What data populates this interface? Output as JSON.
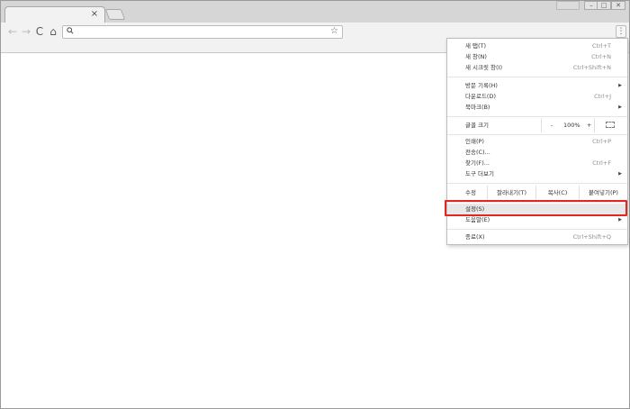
{
  "browser": {
    "tab_close": "×",
    "nav": {
      "back": "←",
      "forward": "→",
      "reload": "C",
      "home": "⌂"
    },
    "omnibox": {
      "value": ""
    },
    "menu_button": "⋮",
    "window_controls": {
      "minimize": "–",
      "maximize": "□",
      "close": "✕"
    }
  },
  "menu": {
    "group1": [
      {
        "label": "새 탭(T)",
        "shortcut": "Ctrl+T"
      },
      {
        "label": "새 창(N)",
        "shortcut": "Ctrl+N"
      },
      {
        "label": "새 시크릿 창(I)",
        "shortcut": "Ctrl+Shift+N"
      }
    ],
    "group2": [
      {
        "label": "방문 기록(H)",
        "shortcut": ""
      },
      {
        "label": "다운로드(D)",
        "shortcut": "Ctrl+J"
      },
      {
        "label": "북마크(B)",
        "shortcut": ""
      }
    ],
    "zoom": {
      "label": "글꼴 크기",
      "minus": "-",
      "value": "100%",
      "plus": "+"
    },
    "group3": [
      {
        "label": "인쇄(P)",
        "shortcut": "Ctrl+P"
      },
      {
        "label": "전송(C)...",
        "shortcut": ""
      },
      {
        "label": "찾기(F)...",
        "shortcut": "Ctrl+F"
      },
      {
        "label": "도구 더보기",
        "shortcut": ""
      }
    ],
    "edit": {
      "label": "수정",
      "cut": "잘라내기(T)",
      "copy": "복사(C)",
      "paste": "붙여넣기(P)"
    },
    "group4": [
      {
        "label": "설정(S)",
        "shortcut": ""
      },
      {
        "label": "도움말(E)",
        "shortcut": ""
      }
    ],
    "group5": [
      {
        "label": "종료(X)",
        "shortcut": "Ctrl+Shift+Q"
      }
    ]
  },
  "colors": {
    "highlight_border": "#e3261f"
  }
}
